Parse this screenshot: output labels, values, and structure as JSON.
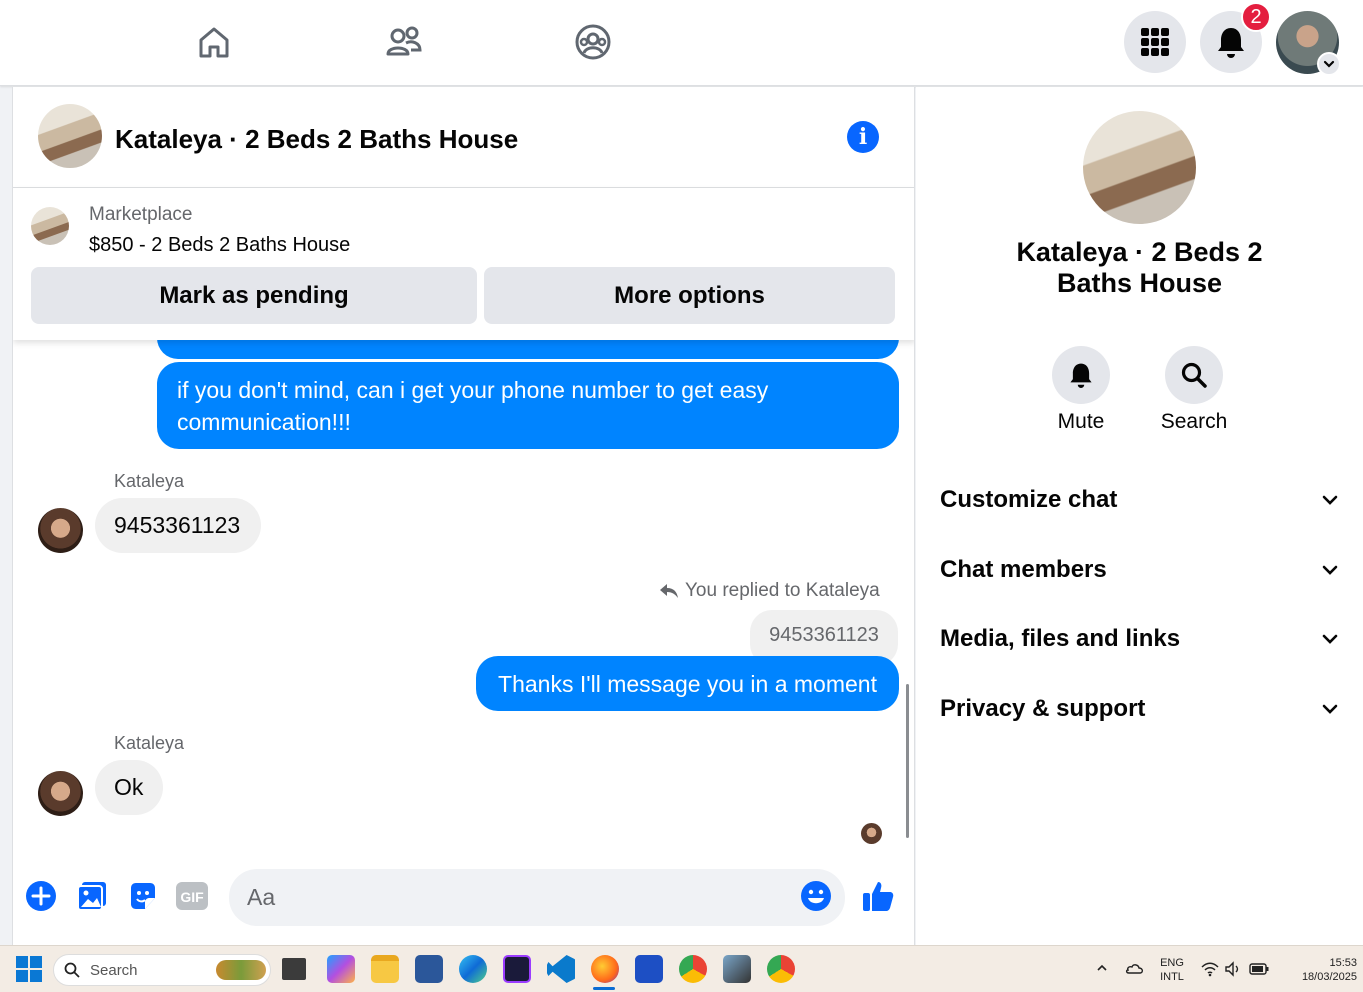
{
  "topbar": {
    "notification_count": "2"
  },
  "chat": {
    "header_title": "Kataleya · 2 Beds 2 Baths House",
    "marketplace": {
      "label": "Marketplace",
      "listing": "$850 - 2 Beds 2 Baths House",
      "mark_pending_label": "Mark as pending",
      "more_options_label": "More options"
    },
    "messages": {
      "out_1": "if you don't mind, can i get your phone number to get easy communication!!!",
      "in_1_sender": "Kataleya",
      "in_1_text": "9453361123",
      "reply_label": "You replied to Kataleya",
      "reply_quote": "9453361123",
      "out_2": "Thanks I'll message you in a moment",
      "in_2_sender": "Kataleya",
      "in_2_text": "Ok"
    },
    "composer": {
      "placeholder": "Aa"
    }
  },
  "sidebar": {
    "title": "Kataleya · 2 Beds 2 Baths House",
    "mute_label": "Mute",
    "search_label": "Search",
    "sections": [
      "Customize chat",
      "Chat members",
      "Media, files and links",
      "Privacy & support"
    ]
  },
  "taskbar": {
    "search_label": "Search",
    "lang_1": "ENG",
    "lang_2": "INTL",
    "time": "15:53",
    "date": "18/03/2025"
  },
  "colors": {
    "accent": "#0084ff",
    "brand_blue": "#0866ff",
    "badge_red": "#e41e3f"
  }
}
